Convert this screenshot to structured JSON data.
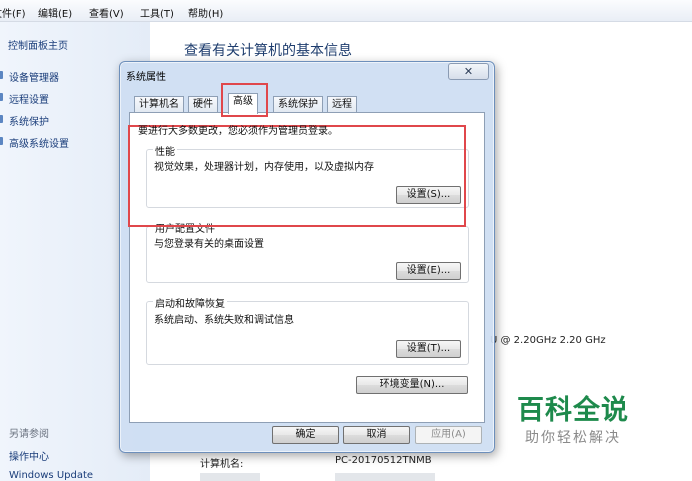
{
  "menubar": {
    "items": [
      "文件(F)",
      "编辑(E)",
      "查看(V)",
      "工具(T)",
      "帮助(H)"
    ]
  },
  "left_nav": {
    "home": "控制面板主页",
    "links": [
      "设备管理器",
      "远程设置",
      "系统保护",
      "高级系统设置"
    ],
    "see_also": "另请参阅",
    "bottom_links": [
      "操作中心",
      "Windows Update"
    ]
  },
  "main": {
    "heading": "查看有关计算机的基本信息",
    "cpu_info": "U @ 2.20GHz   2.20 GHz",
    "computer_name_label": "计算机名:",
    "computer_name_value": "PC-20170512TNMB"
  },
  "dialog": {
    "title": "系统属性",
    "close_glyph": "✕",
    "tabs": [
      "计算机名",
      "硬件",
      "高级",
      "系统保护",
      "远程"
    ],
    "active_tab": "高级",
    "admin_note": "要进行大多数更改，您必须作为管理员登录。",
    "performance": {
      "legend": "性能",
      "desc": "视觉效果，处理器计划，内存使用，以及虚拟内存",
      "button": "设置(S)..."
    },
    "user_profiles": {
      "legend": "用户配置文件",
      "desc": "与您登录有关的桌面设置",
      "button": "设置(E)..."
    },
    "startup_recovery": {
      "legend": "启动和故障恢复",
      "desc": "系统启动、系统失败和调试信息",
      "button": "设置(T)..."
    },
    "env_button": "环境变量(N)...",
    "ok_button": "确定",
    "cancel_button": "取消",
    "apply_button": "应用(A)"
  },
  "watermark": {
    "title": "百科全说",
    "subtitle": "助你轻松解决"
  },
  "colors": {
    "highlight": "#e0474b",
    "watermark_green": "#1e8a4c",
    "link_blue": "#1a3d7a"
  }
}
